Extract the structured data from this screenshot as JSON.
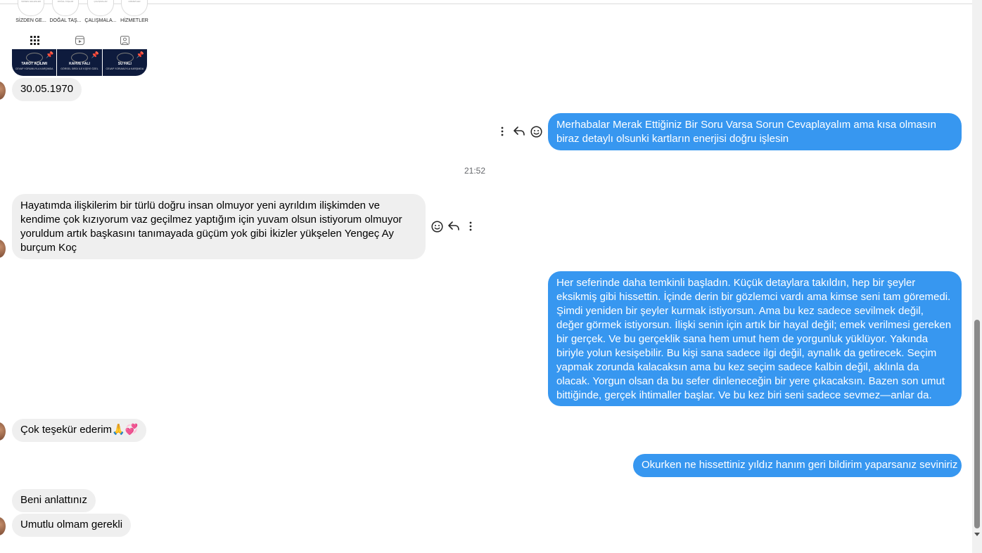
{
  "shared_post": {
    "highlights": [
      {
        "label": "SİZDEN GE...",
        "cover": "SİZDEN GELENLER"
      },
      {
        "label": "DOĞAL TAŞ...",
        "cover": "DOĞAL TAŞLAR"
      },
      {
        "label": "ÇALIŞMALA...",
        "cover": "ÇALIŞMALAR"
      },
      {
        "label": "HİZMETLER",
        "cover": "HİZMETLER"
      }
    ],
    "tabs": [
      "grid-icon",
      "reels-icon",
      "tagged-icon"
    ],
    "posts": [
      {
        "title": "TAROT AÇILIMI",
        "subtitle": "CEVAP YORUMUYLA KARŞIMDA"
      },
      {
        "title": "KAHVE FALI",
        "subtitle": "GÖRSEL SIRDI İLE KİŞİYE ÖZEL"
      },
      {
        "title": "SU FALI",
        "subtitle": "CEVAP YORUMUYLA KARŞIMDA"
      }
    ]
  },
  "messages": {
    "m1": "30.05.1970",
    "m2": "Merhabalar Merak Ettiğiniz Bir Soru Varsa Sorun Cevaplayalım ama kısa olmasın biraz detaylı olsunki kartların enerjisi doğru işlesin",
    "timestamp": "21:52",
    "m3": "Hayatımda ilişkilerim bir türlü doğru insan olmuyor yeni ayrıldım ilişkimden ve kendime çok kızıyorum vaz geçilmez yaptığım için yuvam olsun istiyorum olmuyor yoruldum artık başkasını tanımayada güçüm yok gibi İkizler yükşelen Yengeç Ay burçum Koç",
    "m4": "Her seferinde daha temkinli başladın. Küçük detaylara takıldın, hep bir şeyler eksikmiş gibi hissettin. İçinde derin bir gözlemci vardı ama kimse seni tam göremedi. Şimdi yeniden bir şeyler kurmak istiyorsun. Ama bu kez sadece sevilmek değil, değer görmek istiyorsun. İlişki senin için artık bir hayal değil; emek verilmesi gereken bir gerçek. Ve bu gerçeklik sana hem umut hem de yorgunluk yüklüyor. Yakında biriyle yolun kesişebilir. Bu kişi sana sadece ilgi değil, aynalık da getirecek. Seçim yapmak zorunda kalacaksın ama bu kez seçim sadece kalbin değil, aklınla da olacak. Yorgun olsan da bu sefer dinleneceğin bir yere çıkacaksın. Bazen son umut bittiğinde, gerçek ihtimaller başlar. Ve bu kez biri seni sadece sevmez—anlar da.",
    "m5": "Çok teşekür ederim🙏💞",
    "m6": "Okurken ne hissettiniz yıldız hanım geri bildirim yaparsanız seviniriz",
    "m7": "Beni anlattınız",
    "m8": "Umutlu olmam gerekli"
  },
  "colors": {
    "outgoing": "#3797f0",
    "incoming": "#efefef"
  }
}
